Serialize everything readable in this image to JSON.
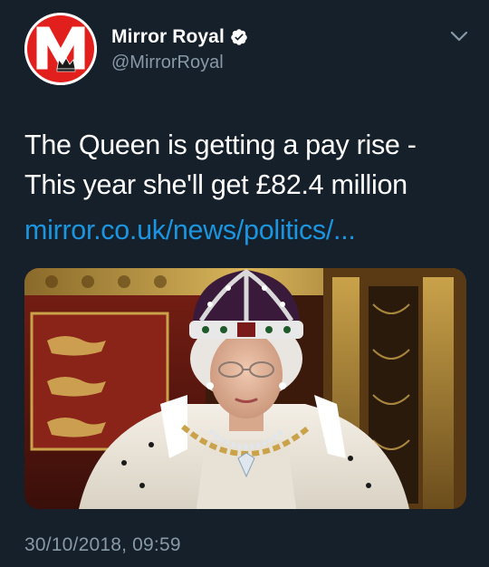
{
  "account": {
    "display_name": "Mirror Royal",
    "handle": "@MirrorRoyal",
    "verified": true,
    "avatar_icon": "mirror-m-logo-icon",
    "avatar_letter": "M",
    "brand_color": "#e1201d"
  },
  "tweet": {
    "text_lines": [
      "The Queen is getting a pay rise -",
      "This year she'll get £82.4 million"
    ],
    "link_text": "mirror.co.uk/news/politics/...",
    "timestamp": "30/10/2018, 09:59"
  },
  "media": {
    "type": "photo",
    "subject": "queen-in-crown-photo"
  },
  "colors": {
    "background": "#15202b",
    "secondary_text": "#8899a6",
    "link": "#1b95e0",
    "verified": "#ffffff"
  },
  "icons": {
    "menu": "chevron-down-icon",
    "verified": "verified-badge-icon"
  }
}
